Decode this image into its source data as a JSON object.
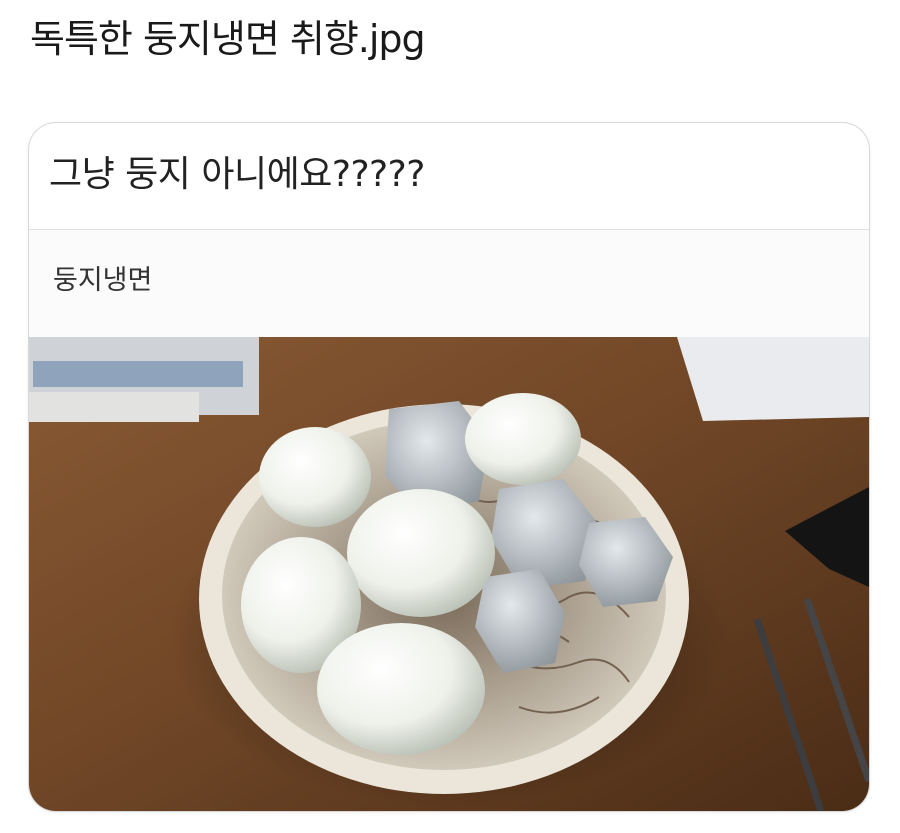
{
  "post": {
    "title": "독특한 둥지냉면 취향.jpg"
  },
  "card": {
    "question": "그냥 둥지 아니에요?????",
    "answer": "둥지냉면"
  }
}
